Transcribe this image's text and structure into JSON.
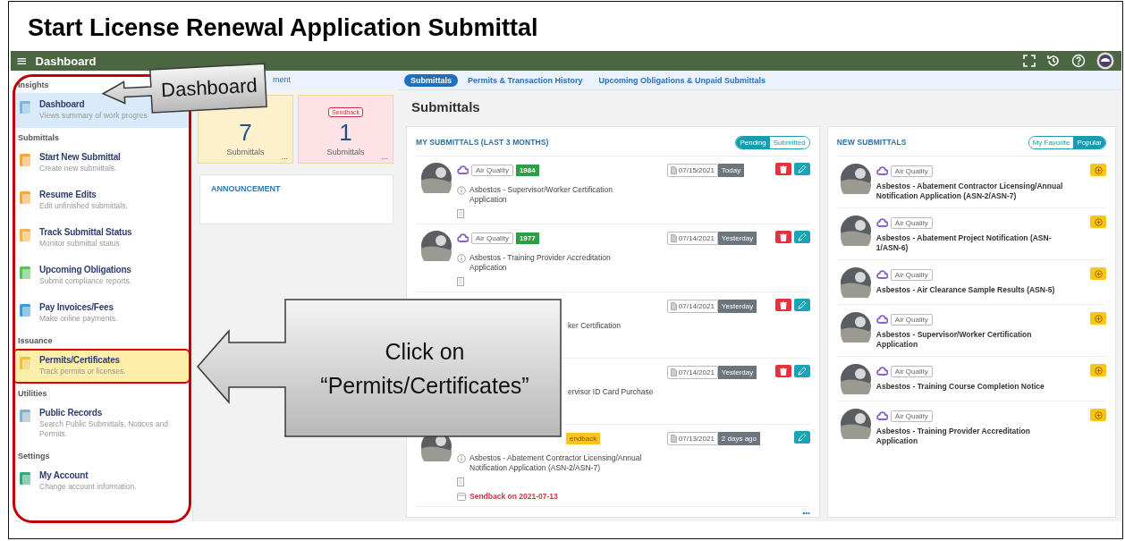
{
  "slide": {
    "title": "Start License Renewal Application Submittal"
  },
  "app": {
    "title": "Dashboard",
    "menu_icon": "≡"
  },
  "sidebar": {
    "sections": [
      {
        "label": "Insights",
        "items": [
          {
            "title": "Dashboard",
            "description": "Views summary of work progres",
            "selected": true,
            "highlighted": false
          }
        ]
      },
      {
        "label": "Submittals",
        "items": [
          {
            "title": "Start New Submittal",
            "description": "Create new submittals.",
            "selected": false,
            "highlighted": false
          },
          {
            "title": "Resume Edits",
            "description": "Edit unfinished submittals.",
            "selected": false,
            "highlighted": false
          },
          {
            "title": "Track Submittal Status",
            "description": "Monitor submittal status",
            "selected": false,
            "highlighted": false
          },
          {
            "title": "Upcoming Obligations",
            "description": "Submit compliance reports.",
            "selected": false,
            "highlighted": false
          },
          {
            "title": "Pay Invoices/Fees",
            "description": "Make online payments.",
            "selected": false,
            "highlighted": false
          }
        ]
      },
      {
        "label": "Issuance",
        "items": [
          {
            "title": "Permits/Certificates",
            "description": "Track permits or licenses.",
            "selected": false,
            "highlighted": true
          }
        ]
      },
      {
        "label": "Utilities",
        "items": [
          {
            "title": "Public Records",
            "description": "Search Public Submittals, Notices and Permits.",
            "selected": false,
            "highlighted": false
          }
        ]
      },
      {
        "label": "Settings",
        "items": [
          {
            "title": "My Account",
            "description": "Change account information.",
            "selected": false,
            "highlighted": false
          }
        ]
      }
    ]
  },
  "overview": {
    "tab_label": "ment",
    "cards": [
      {
        "count": "7",
        "caption": "Submittals",
        "more": "...",
        "color": "#fdf1cc"
      },
      {
        "badge": "Sendback",
        "count": "1",
        "caption": "Submittals",
        "more": "...",
        "color": "#fde3e6"
      }
    ],
    "announcement": "ANNOUNCEMENT"
  },
  "tabs": [
    {
      "label": "Submittals",
      "selected": true
    },
    {
      "label": "Permits & Transaction History",
      "selected": false
    },
    {
      "label": "Upcoming Obligations & Unpaid Submittals",
      "selected": false
    }
  ],
  "heading": "Submittals",
  "my_submittals": {
    "title": "MY SUBMITTALS (LAST 3 MONTHS)",
    "toggle": [
      {
        "label": "Pending",
        "selected": true
      },
      {
        "label": "Submitted",
        "selected": false
      }
    ],
    "rows": [
      {
        "kind": "full",
        "category": "Air Quality",
        "number": "1984",
        "title": "Asbestos - Supervisor/Worker Certification Application",
        "date": "07/15/2021",
        "when": "Today",
        "deletable": true
      },
      {
        "kind": "full",
        "category": "Air Quality",
        "number": "1977",
        "title": "Asbestos - Training Provider Accreditation Application",
        "date": "07/14/2021",
        "when": "Yesterday",
        "deletable": true
      },
      {
        "kind": "covered",
        "title": "ker Certification",
        "date": "07/14/2021",
        "when": "Yesterday",
        "deletable": true
      },
      {
        "kind": "covered",
        "title": "ervisor ID Card Purchase",
        "date": "07/14/2021",
        "when": "Yesterday",
        "deletable": true
      },
      {
        "kind": "covered-tags",
        "status": "endback",
        "title": "Asbestos - Abatement Contractor Licensing/Annual Notification Application (ASN-2/ASN-7)",
        "date": "07/13/2021",
        "when": "2 days ago",
        "deletable": false,
        "note": "Sendback on 2021-07-13"
      }
    ],
    "more": "•••"
  },
  "new_submittals": {
    "title": "NEW SUBMITTALS",
    "toggle": [
      {
        "label": "My Favorite",
        "selected": false
      },
      {
        "label": "Popular",
        "selected": true
      }
    ],
    "rows": [
      {
        "category": "Air Quality",
        "title": "Asbestos - Abatement Contractor Licensing/Annual Notification Application (ASN-2/ASN-7)"
      },
      {
        "category": "Air Quality",
        "title": "Asbestos - Abatement Project Notification (ASN-1/ASN-6)"
      },
      {
        "category": "Air Quality",
        "title": "Asbestos - Air Clearance Sample Results (ASN-5)"
      },
      {
        "category": "Air Quality",
        "title": "Asbestos - Supervisor/Worker Certification Application"
      },
      {
        "category": "Air Quality",
        "title": "Asbestos - Training Course Completion Notice"
      },
      {
        "category": "Air Quality",
        "title": "Asbestos - Training Provider Accreditation Application"
      }
    ]
  },
  "callouts": [
    {
      "kind": "small",
      "text": "Dashboard"
    },
    {
      "kind": "large",
      "text": "Click on\n“Permits/Certificates”"
    }
  ]
}
